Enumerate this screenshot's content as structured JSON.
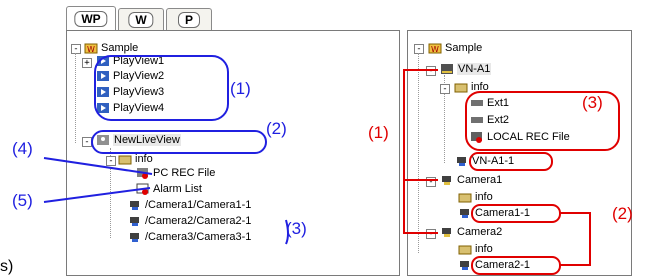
{
  "tabs": [
    {
      "label": "WP",
      "active": true
    },
    {
      "label": "W",
      "active": false
    },
    {
      "label": "P",
      "active": false
    }
  ],
  "left_tree": {
    "root": "Sample",
    "views": [
      "PlayView1",
      "PlayView2",
      "PlayView3",
      "PlayView4"
    ],
    "live_view": "NewLiveView",
    "info": "info",
    "pc_rec": "PC REC File",
    "alarm": "Alarm List",
    "cameras": [
      "/Camera1/Camera1-1",
      "/Camera2/Camera2-1",
      "/Camera3/Camera3-1"
    ]
  },
  "right_tree": {
    "root": "Sample",
    "vn": "VN-A1",
    "info": "info",
    "ext1": "Ext1",
    "ext2": "Ext2",
    "local_rec": "LOCAL REC File",
    "vn_cam": "VN-A1-1",
    "camera1": "Camera1",
    "camera1_info": "info",
    "camera1_1": "Camera1-1",
    "camera2": "Camera2",
    "camera2_info": "info",
    "camera2_1": "Camera2-1"
  },
  "callouts": {
    "l1": "(1)",
    "l2": "(2)",
    "l3": "(3)",
    "l4": "(4)",
    "l5": "(5)",
    "r1": "(1)",
    "r2": "(2)",
    "r3": "(3)"
  },
  "edge_text": "s)",
  "colors": {
    "blue": "#2020e0",
    "red": "#e00000"
  }
}
